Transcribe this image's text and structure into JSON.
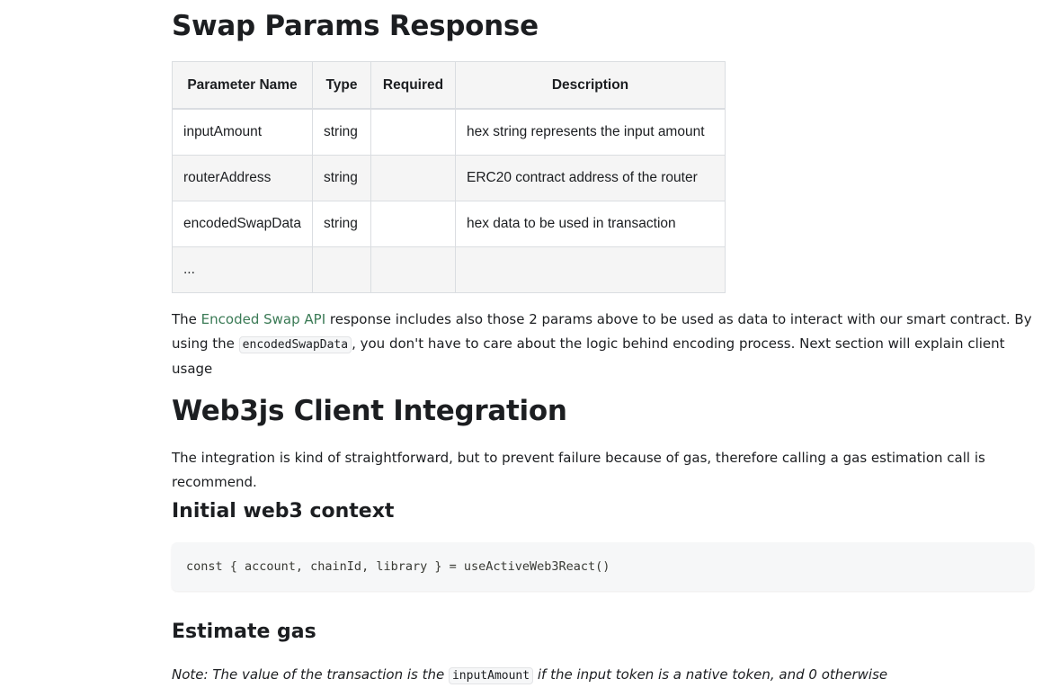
{
  "section1": {
    "title": "Swap Params Response",
    "table": {
      "headers": [
        "Parameter Name",
        "Type",
        "Required",
        "Description"
      ],
      "rows": [
        [
          "inputAmount",
          "string",
          "",
          "hex string represents the input amount"
        ],
        [
          "routerAddress",
          "string",
          "",
          "ERC20 contract address of the router"
        ],
        [
          "encodedSwapData",
          "string",
          "",
          "hex data to be used in transaction"
        ],
        [
          "...",
          "",
          "",
          ""
        ]
      ]
    },
    "para": {
      "pre_link": "The ",
      "link": "Encoded Swap API",
      "after_link": " response includes also those 2 params above to be used as data to interact with our smart contract. By using the ",
      "code": "encodedSwapData",
      "post_code": ", you don't have to care about the logic behind encoding process. Next section will explain client usage"
    }
  },
  "section2": {
    "title": "Web3js Client Integration",
    "intro": "The integration is kind of straightforward, but to prevent failure because of gas, therefore calling a gas estimation call is recommend.",
    "sub1": {
      "title": "Initial web3 context",
      "code": "const { account, chainId, library } = useActiveWeb3React()"
    },
    "sub2": {
      "title": "Estimate gas",
      "note_pre": "Note: The value of the transaction is the ",
      "note_code": "inputAmount",
      "note_post": " if the input token is a native token, and 0 otherwise"
    }
  },
  "colors": {
    "link": "#3a7a55",
    "text": "#1c1e21",
    "table_alt": "#f5f5f5"
  }
}
